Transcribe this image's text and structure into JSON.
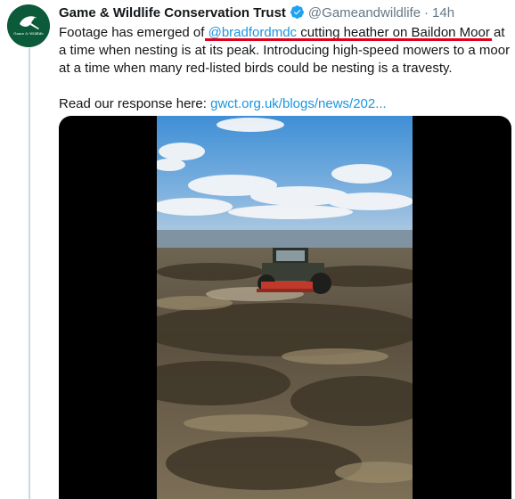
{
  "tweet": {
    "author_name": "Game & Wildlife Conservation Trust",
    "handle": "@Gameandwildlife",
    "separator": "·",
    "time": "14h",
    "avatar_text": "Game & Wildlife",
    "text_segments": [
      "Footage has emerged of ",
      "@bradfordmdc",
      " cutting heather on Baildon Moor at a time when nesting is at its peak. Introducing high-speed mowers to a moor at a time when many red-listed birds could be nesting is a travesty."
    ],
    "read_prefix": "Read our response here: ",
    "link_text": "gwct.org.uk/blogs/news/202...",
    "verified_icon": "verified-badge-icon",
    "media": {
      "type": "video",
      "description_icon": "video-player"
    }
  },
  "colors": {
    "link": "#1b95e0",
    "verified": "#1da1f2",
    "annotation": "#e0001b",
    "avatar": "#0b5a3a"
  }
}
